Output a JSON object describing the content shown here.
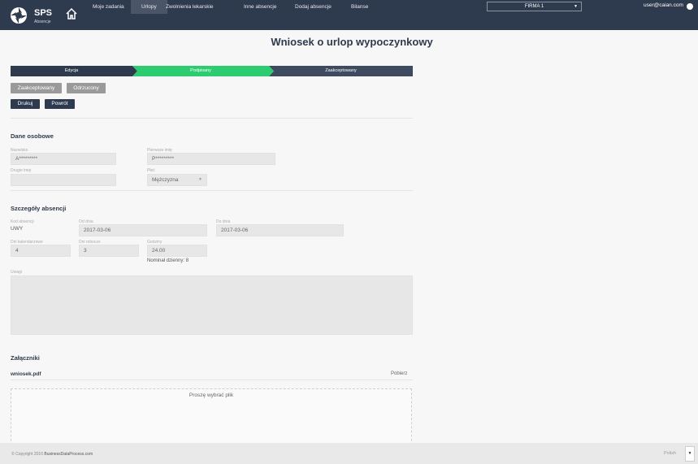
{
  "nav": {
    "logo_title": "SPS",
    "logo_subtitle": "Absencje",
    "items": [
      "Moje zadania",
      "Urlopy",
      "Zwolnienia lekarskie",
      "Inne absencje",
      "Dodaj absencje",
      "Bilanse"
    ],
    "company": "FIRMA 1",
    "user": "user@caian.com"
  },
  "page_title": "Wniosek o urlop wypoczynkowy",
  "stepper": [
    "Edycja",
    "Podpisany",
    "Zaakceptowany"
  ],
  "actions": {
    "accepted": "Zaakceptowany",
    "rejected": "Odrzucony",
    "print": "Drukuj",
    "back": "Powrót"
  },
  "personal": {
    "title": "Dane osobowe",
    "surname_label": "Nazwisko",
    "surname_value": "A*********",
    "firstname_label": "Pierwsze imię",
    "firstname_value": "P*********",
    "middlename_label": "Drugie imię",
    "middlename_value": "",
    "gender_label": "Płeć",
    "gender_value": "Mężczyzna"
  },
  "absence": {
    "title": "Szczegóły absencji",
    "code_label": "Kod absencji",
    "code_value": "UWY",
    "from_label": "Od dnia",
    "from_value": "2017-03-06",
    "to_label": "Do dnia",
    "to_value": "2017-03-06",
    "cal_days_label": "Dni kalendarzowe",
    "cal_days_value": "4",
    "work_days_label": "Dni robocze",
    "work_days_value": "3",
    "hours_label": "Godziny",
    "hours_value": "24.00",
    "norm_text": "Nominał dzienny: 8",
    "notes_label": "Uwagi"
  },
  "attachments": {
    "title": "Załączniki",
    "file": "wniosek.pdf",
    "download": "Pobierz",
    "drop_text": "Proszę wybrać plik"
  },
  "footer": {
    "copyright_prefix": "© Copyright 2016",
    "copyright_company": "BusinessDataProcess.com",
    "language": "Polish"
  },
  "colors": {
    "nav": "#2e3a4d",
    "step_active": "#2ecc71",
    "step_inactive": "#3d4a5f"
  }
}
